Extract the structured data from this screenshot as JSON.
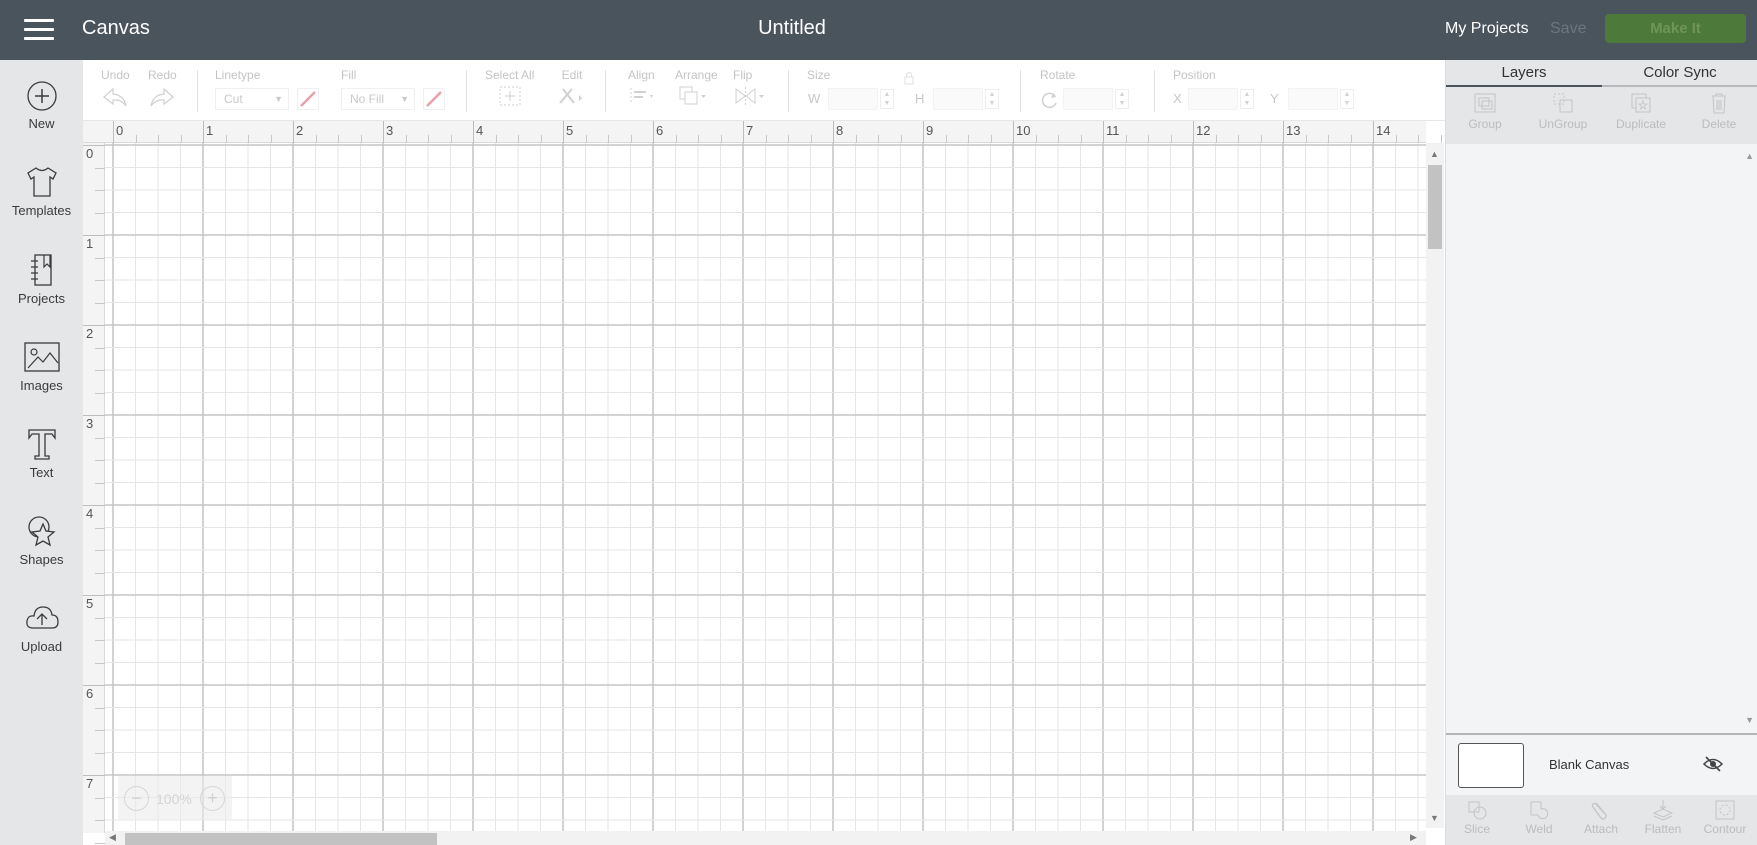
{
  "header": {
    "menu_icon": "hamburger-icon",
    "app_title": "Canvas",
    "document_title": "Untitled",
    "my_projects": "My Projects",
    "save": "Save",
    "make_it": "Make It",
    "make_it_color": "#4d7a3a"
  },
  "sidebar": {
    "items": [
      {
        "label": "New",
        "icon": "plus-circle-icon"
      },
      {
        "label": "Templates",
        "icon": "tshirt-icon"
      },
      {
        "label": "Projects",
        "icon": "notebook-icon"
      },
      {
        "label": "Images",
        "icon": "image-icon"
      },
      {
        "label": "Text",
        "icon": "text-icon"
      },
      {
        "label": "Shapes",
        "icon": "shapes-icon"
      },
      {
        "label": "Upload",
        "icon": "cloud-upload-icon"
      }
    ]
  },
  "toolbar": {
    "undo": "Undo",
    "redo": "Redo",
    "linetype_label": "Linetype",
    "linetype_value": "Cut",
    "fill_label": "Fill",
    "fill_value": "No Fill",
    "select_all": "Select All",
    "edit": "Edit",
    "align": "Align",
    "arrange": "Arrange",
    "flip": "Flip",
    "size_label": "Size",
    "width_label": "W",
    "height_label": "H",
    "width_value": "",
    "height_value": "",
    "rotate_label": "Rotate",
    "rotate_value": "",
    "position_label": "Position",
    "x_label": "X",
    "y_label": "Y",
    "x_value": "",
    "y_value": "",
    "swatch_color": "#e8a0a8"
  },
  "canvas": {
    "ruler_x": [
      "0",
      "1",
      "2",
      "3",
      "4",
      "5",
      "6",
      "7",
      "8",
      "9",
      "10",
      "11",
      "12",
      "13",
      "14"
    ],
    "ruler_y": [
      "0",
      "1",
      "2",
      "3",
      "4",
      "5",
      "6",
      "7"
    ],
    "zoom_level": "100%",
    "zoom_out_icon": "minus-circle-icon",
    "zoom_in_icon": "plus-circle-icon"
  },
  "right_panel": {
    "tabs": [
      {
        "label": "Layers",
        "active": true
      },
      {
        "label": "Color Sync",
        "active": false
      }
    ],
    "layer_actions": [
      "Group",
      "UnGroup",
      "Duplicate",
      "Delete"
    ],
    "blank_canvas_label": "Blank Canvas",
    "visibility_icon": "eye-hidden-icon",
    "bottom_actions": [
      "Slice",
      "Weld",
      "Attach",
      "Flatten",
      "Contour"
    ]
  }
}
